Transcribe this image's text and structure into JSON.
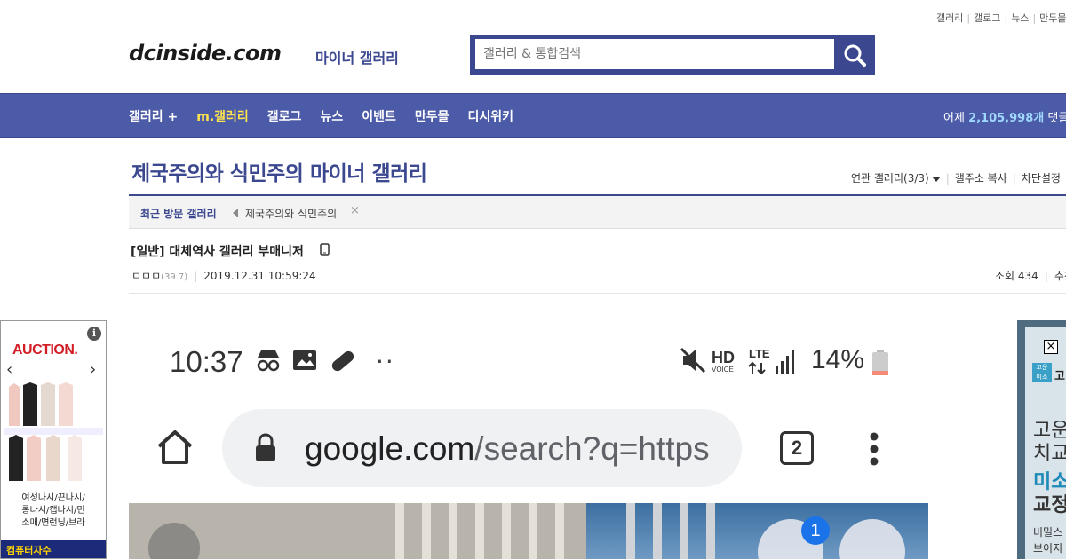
{
  "top_util": [
    "갤러리",
    "갤로그",
    "뉴스",
    "만두몰"
  ],
  "header": {
    "logo": "dcinside.com",
    "logo_sub": "마이너 갤러리",
    "search_placeholder": "갤러리 & 통합검색"
  },
  "nav": {
    "items": [
      "갤러리 +",
      "m.갤러리",
      "갤로그",
      "뉴스",
      "이벤트",
      "만두몰",
      "디시위키"
    ],
    "stats_prefix": "어제",
    "stats_value": "2,105,998개",
    "stats_suffix": "댓글"
  },
  "gallery": {
    "title": "제국주의와 식민주의 마이너 갤러리",
    "tools": [
      "연관 갤러리(3/3)",
      "갤주소 복사",
      "차단설정"
    ]
  },
  "recent": {
    "label": "최근 방문 갤러리",
    "item": "제국주의와 식민주의",
    "close": "×"
  },
  "post": {
    "title": "[일반] 대체역사 갤러리 부매니저",
    "author": "ㅁㅁㅁ",
    "ip": "(39.7)",
    "date": "2019.12.31 10:59:24",
    "views": "조회 434",
    "recommend": "추천"
  },
  "left_ad": {
    "logo": "AUCTION.",
    "info": "i",
    "prev": "‹",
    "next": "›",
    "caption_line1": "여성나시/끈나시/",
    "caption_line2": "롱나시/캡나시/민",
    "caption_line3": "소매/면런닝/브라",
    "ad2_text": "컴퓨터자수"
  },
  "right_ad": {
    "close": "×",
    "logo_text": "고",
    "h1": "고운\n치교",
    "h2": "미소",
    "h3": "교정",
    "small": "비밀스\n보이지"
  },
  "screenshot": {
    "time": "10:37",
    "dots": "··",
    "battery": "14%",
    "hd_label": "HD",
    "voice_label": "VOICE",
    "lte_label": "LTE",
    "url_domain": "google.com",
    "url_path": "/search?q=https",
    "tabs_count": "2",
    "badge_count": "1"
  },
  "colors": {
    "brand": "#3b4890",
    "nav_bg": "#4c5ba8",
    "highlight": "#ffe44c"
  }
}
